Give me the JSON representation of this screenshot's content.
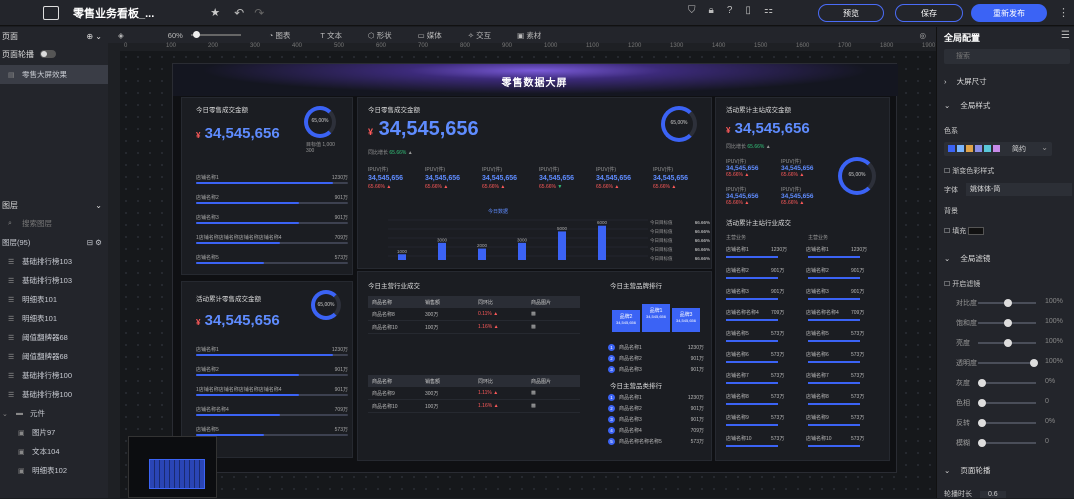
{
  "app": {
    "title": "零售业务看板_..."
  },
  "toolbar": {
    "zoom": "60%",
    "tools": [
      "图表",
      "文本",
      "形状",
      "媒体",
      "交互",
      "素材"
    ]
  },
  "buttons": {
    "preview": "预览",
    "save": "保存",
    "publish": "重新发布"
  },
  "ruler": [
    "0",
    "100",
    "200",
    "300",
    "400",
    "500",
    "600",
    "700",
    "800",
    "900",
    "1000",
    "1100",
    "1200",
    "1300",
    "1400",
    "1500",
    "1600",
    "1700",
    "1800",
    "1900"
  ],
  "left": {
    "pages_label": "页面",
    "carousel_label": "页面轮播",
    "page_item": "零售大屏效果",
    "layers_label": "图层",
    "layer_search": "搜索图层",
    "layer_group": "图层(95)",
    "layers": [
      "基础排行榜103",
      "基础排行榜103",
      "明细表101",
      "明细表101",
      "阈值翻牌器68",
      "阈值翻牌器68",
      "基础排行榜100",
      "基础排行榜100"
    ],
    "folder": "元件",
    "children": [
      "图片97",
      "文本104",
      "明细表102"
    ]
  },
  "screen": {
    "title": "零售数据大屏",
    "p1": {
      "title": "今日零售成交金额",
      "value": "34,545,656",
      "currency": "¥",
      "ring": "65,00%",
      "ring_sub": "目标值 1,000",
      "ring_sub2": "300",
      "growth_label": "同比增长",
      "growth": "65.66%"
    },
    "p2": {
      "title": "活动累计零售成交金额",
      "value": "34,545,656",
      "currency": "¥",
      "ring": "65,00%"
    },
    "rank_left": {
      "items": [
        {
          "name": "店铺名称1",
          "value": "1230万",
          "pct": 0.9
        },
        {
          "name": "店铺名称2",
          "value": "901万",
          "pct": 0.68
        },
        {
          "name": "店铺名称3",
          "value": "901万",
          "pct": 0.68
        },
        {
          "name": "1店铺名称店铺名称店铺名称店铺名称4",
          "value": "709万",
          "pct": 0.55
        },
        {
          "name": "店铺名称5",
          "value": "573万",
          "pct": 0.45
        }
      ]
    },
    "rank_left2": {
      "items": [
        {
          "name": "店铺名称1",
          "value": "1230万",
          "pct": 0.9
        },
        {
          "name": "店铺名称2",
          "value": "901万",
          "pct": 0.68
        },
        {
          "name": "1店铺名称店铺名称店铺名称店铺名称4",
          "value": "901万",
          "pct": 0.68
        },
        {
          "name": "店铺名称名称4",
          "value": "709万",
          "pct": 0.55
        },
        {
          "name": "店铺名称5",
          "value": "573万",
          "pct": 0.45
        }
      ]
    },
    "center": {
      "title": "今日零售成交金额",
      "currency": "¥",
      "value": "34,545,656",
      "ring": "65,00%",
      "growth_label": "同比增长",
      "growth": "65.66%",
      "kpis": [
        {
          "label": "IPUV(件)",
          "value": "34,545,656",
          "delta": "65.66%",
          "dir": "up"
        },
        {
          "label": "IPUV(件)",
          "value": "34,545,656",
          "delta": "65.66%",
          "dir": "up"
        },
        {
          "label": "IPUV(件)",
          "value": "34,545,656",
          "delta": "65.66%",
          "dir": "up"
        },
        {
          "label": "IPUV(件)",
          "value": "34,545,656",
          "delta": "65.66%",
          "dir": "down"
        },
        {
          "label": "IPUV(件)",
          "value": "34,545,656",
          "delta": "65.66%",
          "dir": "up"
        },
        {
          "label": "IPUV(件)",
          "value": "34,545,656",
          "delta": "65.66%",
          "dir": "up"
        }
      ],
      "legend": "今日数据",
      "side": [
        {
          "label": "今日目标值",
          "value": "66.66%"
        },
        {
          "label": "今日目标值",
          "value": "66.66%"
        },
        {
          "label": "今日目标值",
          "value": "66.66%"
        },
        {
          "label": "今日目标值",
          "value": "66.66%"
        },
        {
          "label": "今日目标值",
          "value": "66.66%"
        }
      ]
    },
    "table1": {
      "title": "今日主营行业成交",
      "headers": [
        "商品名称",
        "销售额",
        "同环比",
        "商品图片"
      ],
      "rows": [
        [
          "商品名称8",
          "300万",
          "0.11%"
        ],
        [
          "商品名称10",
          "100万",
          "1.16%"
        ]
      ]
    },
    "table2": {
      "headers": [
        "商品名称",
        "销售额",
        "同环比",
        "商品图片"
      ],
      "rows": [
        [
          "商品名称9",
          "300万",
          "1.11%"
        ],
        [
          "商品名称10",
          "100万",
          "1.16%"
        ]
      ]
    },
    "rank_center": {
      "title": "今日主营品牌排行",
      "podium": [
        {
          "name": "品牌2",
          "value": "34,545,656"
        },
        {
          "name": "品牌1",
          "value": "34,545,656"
        },
        {
          "name": "品牌3",
          "value": "34,545,656"
        }
      ],
      "items": [
        {
          "name": "商品名称1",
          "value": "1230万"
        },
        {
          "name": "商品名称2",
          "value": "901万"
        },
        {
          "name": "商品名称3",
          "value": "901万"
        }
      ]
    },
    "rank_center2": {
      "title": "今日主营品类排行",
      "items": [
        {
          "name": "商品名称1",
          "value": "1230万"
        },
        {
          "name": "商品名称2",
          "value": "901万"
        },
        {
          "name": "商品名称3",
          "value": "901万"
        },
        {
          "name": "商品名称4",
          "value": "709万"
        },
        {
          "name": "商品名称名称名称5",
          "value": "573万"
        }
      ]
    },
    "right": {
      "title": "活动累计主站成交金额",
      "currency": "¥",
      "value": "34,545,656",
      "growth_label": "同比增长",
      "growth": "65.66%",
      "ring": "65,00%",
      "kpis": [
        {
          "label": "IPUV(件)",
          "value": "34,545,656",
          "delta": "65.66%"
        },
        {
          "label": "IPUV(件)",
          "value": "34,545,656",
          "delta": "65.66%"
        },
        {
          "label": "IPUV(件)",
          "value": "34,545,656",
          "delta": "65.66%"
        },
        {
          "label": "IPUV(件)",
          "value": "34,545,656",
          "delta": "65.66%"
        }
      ],
      "sub_title": "活动累计主站行业成交",
      "col_a": "主营业务",
      "col_b": "主营业务",
      "grid": [
        [
          "店铺名称1",
          "1230万",
          "店铺名称1",
          "1230万"
        ],
        [
          "店铺名称2",
          "901万",
          "店铺名称2",
          "901万"
        ],
        [
          "店铺名称3",
          "901万",
          "店铺名称3",
          "901万"
        ],
        [
          "店铺名称名称4",
          "709万",
          "店铺名称名称4",
          "709万"
        ],
        [
          "店铺名称5",
          "573万",
          "店铺名称5",
          "573万"
        ],
        [
          "店铺名称6",
          "573万",
          "店铺名称6",
          "573万"
        ],
        [
          "店铺名称7",
          "573万",
          "店铺名称7",
          "573万"
        ],
        [
          "店铺名称8",
          "573万",
          "店铺名称8",
          "573万"
        ],
        [
          "店铺名称9",
          "573万",
          "店铺名称9",
          "573万"
        ],
        [
          "店铺名称10",
          "573万",
          "店铺名称10",
          "573万"
        ]
      ]
    }
  },
  "chart_data": {
    "type": "bar",
    "categories": [
      "",
      "",
      "",
      "",
      "",
      ""
    ],
    "values": [
      1000,
      3000,
      2000,
      3000,
      5000,
      6000
    ],
    "data_labels": [
      "1000",
      "3000",
      "2000",
      "3000",
      "5000",
      "6000"
    ],
    "ylim": [
      0,
      7000
    ]
  },
  "rightpanel": {
    "title": "全局配置",
    "search": "搜索",
    "sec_size": "大屏尺寸",
    "sec_style": "全局样式",
    "color_label": "色系",
    "color_value": "简约",
    "gradient": "渐变色彩样式",
    "font_label": "字体",
    "font_value": "姚体体-简",
    "bg_label": "背景",
    "bg_fill": "填充",
    "filter": "全局滤镜",
    "enable_filter": "开启滤镜",
    "sliders": [
      {
        "label": "对比度",
        "value": "100%",
        "level": 0.5
      },
      {
        "label": "饱和度",
        "value": "100%",
        "level": 0.5
      },
      {
        "label": "亮度",
        "value": "100%",
        "level": 0.5
      },
      {
        "label": "透明度",
        "value": "100%",
        "level": 1
      },
      {
        "label": "灰度",
        "value": "0%",
        "level": 0
      },
      {
        "label": "色相",
        "value": "0",
        "level": 0
      },
      {
        "label": "反转",
        "value": "0%",
        "level": 0
      },
      {
        "label": "模糊",
        "value": "0",
        "level": 0
      }
    ],
    "carousel": "页面轮播",
    "interval_label": "轮播时长",
    "interval": "0.6"
  },
  "colors": {
    "accent": "#3b63f5",
    "bg": "#1b1d21"
  }
}
